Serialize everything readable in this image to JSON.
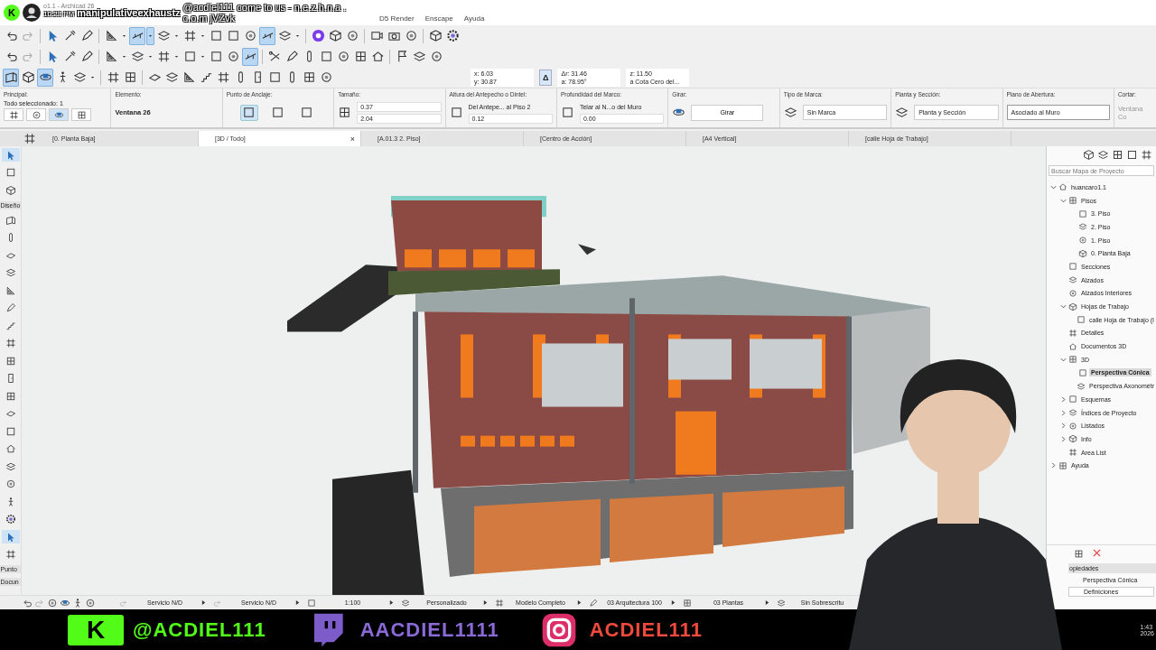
{
  "window": {
    "title": "o1.1 - Archicad 26"
  },
  "stream_chat": {
    "logo_letter": "K",
    "time": "10:23 PM",
    "user": "manipulativeexhaustz",
    "message": "@acdiel111 come to us - n.e.z.h.n.a . c.o.m jVZvk"
  },
  "menu": [
    "D5 Render",
    "Enscape",
    "Ayuda"
  ],
  "delta_button": "Δ",
  "toolbars": [
    {
      "items": [
        {
          "kind": "undo",
          "selected": false
        },
        {
          "kind": "redo",
          "selected": false
        },
        {
          "kind": "sep"
        },
        {
          "kind": "pointer",
          "selected": false
        },
        {
          "kind": "eyedropper",
          "selected": false
        },
        {
          "kind": "pen",
          "selected": false
        },
        {
          "kind": "sep"
        },
        {
          "kind": "triangle",
          "selected": false
        },
        {
          "kind": "caret",
          "selected": false
        },
        {
          "kind": "snap",
          "selected": true
        },
        {
          "kind": "caret",
          "selected": true
        },
        {
          "kind": "layers",
          "selected": false
        },
        {
          "kind": "caret",
          "selected": false
        },
        {
          "kind": "grid",
          "selected": false
        },
        {
          "kind": "caret",
          "selected": false
        },
        {
          "kind": "square",
          "selected": false
        },
        {
          "kind": "square",
          "selected": false
        },
        {
          "kind": "target",
          "selected": false
        },
        {
          "kind": "snap",
          "selected": true
        },
        {
          "kind": "layers",
          "selected": false
        },
        {
          "kind": "caret",
          "selected": false
        },
        {
          "kind": "sep"
        },
        {
          "kind": "plugin",
          "selected": false
        },
        {
          "kind": "cube",
          "selected": false
        },
        {
          "kind": "target",
          "selected": false
        },
        {
          "kind": "sep"
        },
        {
          "kind": "video",
          "selected": false
        },
        {
          "kind": "camera",
          "selected": false
        },
        {
          "kind": "target",
          "selected": false
        },
        {
          "kind": "sep"
        },
        {
          "kind": "cube",
          "selected": false
        },
        {
          "kind": "gear",
          "selected": false
        }
      ]
    },
    {
      "items": [
        {
          "kind": "undo",
          "selected": false
        },
        {
          "kind": "redo",
          "selected": false
        },
        {
          "kind": "sep"
        },
        {
          "kind": "pointer",
          "selected": false
        },
        {
          "kind": "eyedropper",
          "selected": false
        },
        {
          "kind": "pen",
          "selected": false
        },
        {
          "kind": "sep"
        },
        {
          "kind": "triangle",
          "selected": false
        },
        {
          "kind": "caret",
          "selected": false
        },
        {
          "kind": "layers",
          "selected": false
        },
        {
          "kind": "caret",
          "selected": false
        },
        {
          "kind": "grid",
          "selected": false
        },
        {
          "kind": "caret",
          "selected": false
        },
        {
          "kind": "square",
          "selected": false
        },
        {
          "kind": "caret",
          "selected": false
        },
        {
          "kind": "square",
          "selected": false
        },
        {
          "kind": "target",
          "selected": false
        },
        {
          "kind": "snap",
          "selected": true
        },
        {
          "kind": "sep"
        },
        {
          "kind": "scissors",
          "selected": false
        },
        {
          "kind": "pen",
          "selected": false
        },
        {
          "kind": "column",
          "selected": false
        },
        {
          "kind": "square",
          "selected": false
        },
        {
          "kind": "target",
          "selected": false
        },
        {
          "kind": "window",
          "selected": false
        },
        {
          "kind": "house",
          "selected": false
        },
        {
          "kind": "sep"
        },
        {
          "kind": "flag",
          "selected": false
        },
        {
          "kind": "layers",
          "selected": false
        },
        {
          "kind": "target",
          "selected": false
        }
      ]
    },
    {
      "items": [
        {
          "kind": "wall",
          "selected": true
        },
        {
          "kind": "cube",
          "selected": false
        },
        {
          "kind": "orbit",
          "selected": true
        },
        {
          "kind": "walker",
          "selected": false
        },
        {
          "kind": "layers",
          "selected": false
        },
        {
          "kind": "caret",
          "selected": false
        },
        {
          "kind": "sep"
        },
        {
          "kind": "grid",
          "selected": false
        },
        {
          "kind": "window",
          "selected": false
        },
        {
          "kind": "sep"
        },
        {
          "kind": "slab",
          "selected": false
        },
        {
          "kind": "layers",
          "selected": false
        },
        {
          "kind": "triangle",
          "selected": false
        },
        {
          "kind": "stairs",
          "selected": false
        },
        {
          "kind": "grid",
          "selected": false
        },
        {
          "kind": "column",
          "selected": false
        },
        {
          "kind": "door",
          "selected": false
        },
        {
          "kind": "square",
          "selected": false
        },
        {
          "kind": "column",
          "selected": false
        },
        {
          "kind": "window",
          "selected": false
        },
        {
          "kind": "target",
          "selected": false
        }
      ]
    }
  ],
  "coordinates": [
    {
      "lines": [
        "x: 6.03",
        "y: 30.87"
      ]
    },
    {
      "lines": [
        "Δr: 31.46",
        "a: 78.95°"
      ]
    },
    {
      "lines": [
        "z: 11.50",
        "a Cota Cero del..."
      ]
    }
  ],
  "info_box": [
    {
      "kind": "principal",
      "label": "Principal:",
      "text": "Todo seleccionado: 1",
      "buttons": [
        {
          "selected": false
        },
        {
          "selected": false
        },
        {
          "selected": true
        },
        {
          "selected": false
        }
      ],
      "disabled": false
    },
    {
      "kind": "value",
      "label": "Elemento:",
      "value": "Ventana 26",
      "disabled": false
    },
    {
      "kind": "anchor",
      "label": "Punto de Anclaje:",
      "options": [
        {
          "selected": true
        },
        {
          "selected": false
        },
        {
          "selected": false
        }
      ],
      "disabled": false
    },
    {
      "kind": "fields",
      "label": "Tamaño:",
      "fields": [
        "0.37",
        "2.04"
      ],
      "disabled": false
    },
    {
      "kind": "select_field",
      "label": "Altura del Antepecho o Dintel:",
      "select": "Del Antepe... al Piso 2",
      "field": "0.12",
      "disabled": false
    },
    {
      "kind": "select_field",
      "label": "Profundidad del Marco:",
      "select": "Telar al N...o del Muro",
      "field": "0.00",
      "disabled": false
    },
    {
      "kind": "button",
      "label": "Girar:",
      "button": "Girar",
      "disabled": false
    },
    {
      "kind": "select",
      "label": "Tipo de Marca:",
      "value": "Sin Marca",
      "disabled": false
    },
    {
      "kind": "select",
      "label": "Planta y Sección:",
      "value": "Planta y Sección",
      "disabled": false
    },
    {
      "kind": "dropdown",
      "label": "Plano de Abertura:",
      "value": "Asociado al Muro",
      "disabled": false
    },
    {
      "kind": "value",
      "label": "Cortar:",
      "value": "Ventana Co",
      "disabled": true
    }
  ],
  "tabs": [
    {
      "label": "[0. Planta Baja]",
      "selected": false
    },
    {
      "label": "[3D / Todo]",
      "selected": true,
      "close": "×"
    },
    {
      "label": "[A.01.3 2. Piso]",
      "selected": false
    },
    {
      "label": "[Centro de Acción]",
      "selected": false
    },
    {
      "label": "[A4 Vertical]",
      "selected": false
    },
    {
      "label": "[calle Hoja de Trabajo]",
      "selected": false
    }
  ],
  "toolbox": [
    {
      "kind": "pointer",
      "selected": true
    },
    {
      "kind": "square",
      "selected": false
    },
    {
      "kind": "cube",
      "selected": false
    },
    {
      "kind": "label",
      "label": "Diseño"
    },
    {
      "kind": "wall",
      "selected": false
    },
    {
      "kind": "column",
      "selected": false
    },
    {
      "kind": "slab",
      "selected": false
    },
    {
      "kind": "layers",
      "selected": false
    },
    {
      "kind": "triangle",
      "selected": false
    },
    {
      "kind": "pen",
      "selected": false
    },
    {
      "kind": "stairs",
      "selected": false
    },
    {
      "kind": "grid",
      "selected": false
    },
    {
      "kind": "window",
      "selected": false
    },
    {
      "kind": "door",
      "selected": false
    },
    {
      "kind": "window",
      "selected": false
    },
    {
      "kind": "slab",
      "selected": false
    },
    {
      "kind": "square",
      "selected": false
    },
    {
      "kind": "house",
      "selected": false
    },
    {
      "kind": "layers",
      "selected": false
    },
    {
      "kind": "target",
      "selected": false
    },
    {
      "kind": "walker",
      "selected": false
    },
    {
      "kind": "gear",
      "selected": false
    },
    {
      "kind": "pointer",
      "selected": true
    },
    {
      "kind": "grid",
      "selected": false
    },
    {
      "kind": "label",
      "label": "Punto"
    },
    {
      "kind": "label",
      "label": "Docun"
    }
  ],
  "navigator": {
    "search": {
      "placeholder": "Buscar Mapa de Proyecto"
    },
    "tree": [
      {
        "label": "huancaro1.1",
        "expanded": true,
        "selected": false,
        "children": [
          {
            "label": "Pisos",
            "expanded": true,
            "selected": false,
            "children": [
              {
                "label": "3. Piso",
                "selected": false
              },
              {
                "label": "2. Piso",
                "selected": false
              },
              {
                "label": "1. Piso",
                "selected": false
              },
              {
                "label": "0. Planta Baja",
                "selected": false
              }
            ]
          },
          {
            "label": "Secciones",
            "selected": false
          },
          {
            "label": "Alzados",
            "selected": false
          },
          {
            "label": "Alzados Interiores",
            "selected": false
          },
          {
            "label": "Hojas de Trabajo",
            "expanded": true,
            "selected": false,
            "children": [
              {
                "label": "calle Hoja de Trabajo (I",
                "selected": false
              }
            ]
          },
          {
            "label": "Detalles",
            "selected": false
          },
          {
            "label": "Documentos 3D",
            "selected": false
          },
          {
            "label": "3D",
            "expanded": true,
            "selected": false,
            "children": [
              {
                "label": "Perspectiva Cónica",
                "selected": true
              },
              {
                "label": "Perspectiva Axonométr",
                "selected": false
              }
            ]
          },
          {
            "label": "Esquemas",
            "expanded": false,
            "selected": false
          },
          {
            "label": "Índices de Proyecto",
            "expanded": false,
            "selected": false
          },
          {
            "label": "Listados",
            "expanded": false,
            "selected": false
          },
          {
            "label": "Info",
            "expanded": false,
            "selected": false
          },
          {
            "label": "Area List",
            "selected": false
          }
        ]
      },
      {
        "label": "Ayuda",
        "expanded": false,
        "selected": false
      }
    ]
  },
  "status_bar": [
    "Servicio N/D",
    "Servicio N/D",
    "1:100",
    "Personalizado",
    "Modelo Completo",
    "03 Arquitectura 100",
    "03 Plantas",
    "Sin Sobrescritu"
  ],
  "properties_panel": {
    "title": "opiedades",
    "items": [
      "Perspectiva Cónica",
      "Definiciones"
    ]
  },
  "banner": [
    {
      "kind": "kick",
      "logo_letter": "K",
      "handle": "@ACDIEL111"
    },
    {
      "kind": "twitch",
      "handle": "AACDIEL1111"
    },
    {
      "kind": "instagram",
      "handle": "ACDIEL111"
    }
  ],
  "taskbar": {
    "time": "1:43",
    "year": "2026"
  }
}
